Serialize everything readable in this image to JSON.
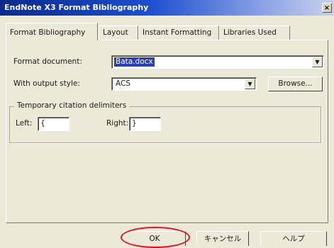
{
  "window": {
    "title": "EndNote X3 Format Bibliography",
    "close_glyph": "×"
  },
  "tabs": [
    {
      "label": "Format Bibliography",
      "active": true
    },
    {
      "label": "Layout",
      "active": false
    },
    {
      "label": "Instant Formatting",
      "active": false
    },
    {
      "label": "Libraries Used",
      "active": false
    }
  ],
  "form": {
    "format_document_label": "Format document:",
    "format_document_value": "Bata.docx",
    "output_style_label": "With output style:",
    "output_style_value": "ACS",
    "browse_label": "Browse..."
  },
  "delimiters": {
    "group_label": "Temporary citation delimiters",
    "left_label": "Left:",
    "left_value": "{",
    "right_label": "Right:",
    "right_value": "}"
  },
  "buttons": {
    "ok": "OK",
    "cancel": "キャンセル",
    "help": "ヘルプ"
  },
  "colors": {
    "selection": "#2a3fb0",
    "highlight_ring": "#e0141e"
  }
}
